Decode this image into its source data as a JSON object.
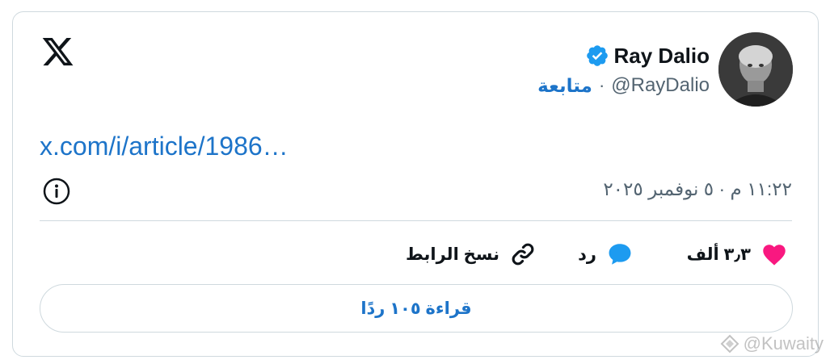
{
  "tweet": {
    "author": {
      "display_name": "Ray Dalio",
      "handle": "@RayDalio",
      "verified": true,
      "verified_color": "#1d9bf0"
    },
    "follow_label": "متابعة",
    "separator": "·",
    "link_text": "x.com/i/article/1986…",
    "timestamp": "١١:٢٢ م · ٥ نوفمبر ٢٠٢٥"
  },
  "actions": {
    "like": {
      "count": "٣٫٣ ألف",
      "icon": "heart-icon",
      "color": "#f91880"
    },
    "reply": {
      "label": "رد",
      "icon": "speech-bubble-icon",
      "color": "#1d9bf0"
    },
    "copy": {
      "label": "نسخ الرابط",
      "icon": "link-icon"
    }
  },
  "read_replies_label": "قراءة ١٠٥ ردًا",
  "watermark": {
    "text": "@Kuwaity"
  },
  "colors": {
    "link": "#1d74c9",
    "secondary_text": "#536471",
    "border": "#cfd9de"
  }
}
